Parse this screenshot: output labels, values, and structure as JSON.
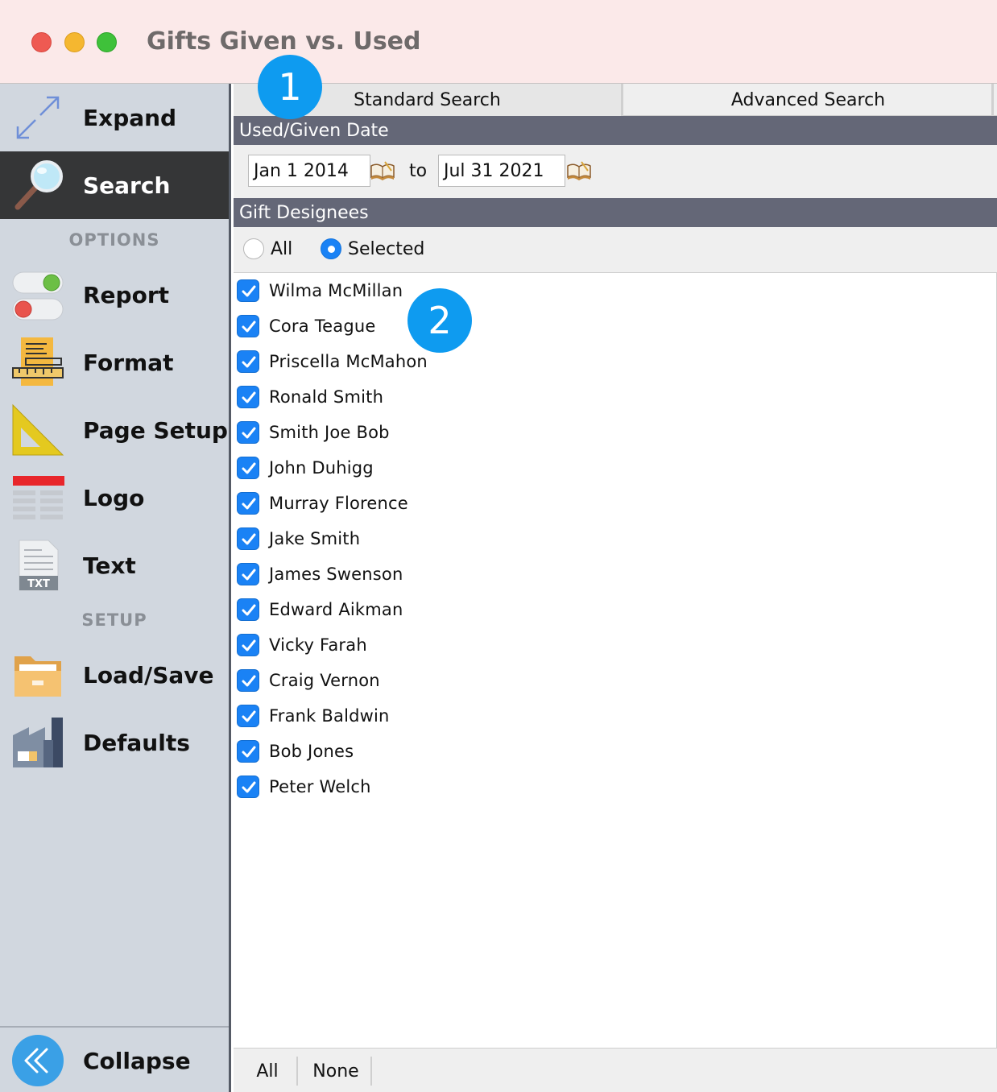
{
  "window": {
    "title": "Gifts Given vs. Used"
  },
  "sidebar": {
    "expand": {
      "label": "Expand",
      "icon": "expand-arrows-icon"
    },
    "search": {
      "label": "Search",
      "icon": "magnifier-icon"
    },
    "options_heading": "OPTIONS",
    "report": {
      "label": "Report",
      "icon": "toggle-switches-icon"
    },
    "format": {
      "label": "Format",
      "icon": "ruler-pencil-icon"
    },
    "page_setup": {
      "label": "Page Setup",
      "icon": "set-square-icon"
    },
    "logo": {
      "label": "Logo",
      "icon": "logo-layout-icon"
    },
    "text": {
      "label": "Text",
      "icon": "txt-file-icon",
      "icon_text": "TXT"
    },
    "setup_heading": "SETUP",
    "load_save": {
      "label": "Load/Save",
      "icon": "folder-icon"
    },
    "defaults": {
      "label": "Defaults",
      "icon": "factory-icon"
    },
    "collapse": {
      "label": "Collapse",
      "icon": "double-chevron-left-icon"
    }
  },
  "tabs": {
    "standard": "Standard Search",
    "advanced": "Advanced Search",
    "active": "standard"
  },
  "date_section": {
    "header": "Used/Given Date",
    "from_value": "Jan 1 2014",
    "to_label": "to",
    "to_value": "Jul 31 2021"
  },
  "designees": {
    "header": "Gift Designees",
    "radio_all": "All",
    "radio_selected": "Selected",
    "selected_option": "Selected",
    "items": [
      {
        "name": "Wilma McMillan",
        "checked": true
      },
      {
        "name": "Cora Teague",
        "checked": true
      },
      {
        "name": "Priscella McMahon",
        "checked": true
      },
      {
        "name": "Ronald Smith",
        "checked": true
      },
      {
        "name": "Smith Joe Bob",
        "checked": true
      },
      {
        "name": "John Duhigg",
        "checked": true
      },
      {
        "name": "Murray Florence",
        "checked": true
      },
      {
        "name": "Jake Smith",
        "checked": true
      },
      {
        "name": "James Swenson",
        "checked": true
      },
      {
        "name": "Edward Aikman",
        "checked": true
      },
      {
        "name": "Vicky Farah",
        "checked": true
      },
      {
        "name": "Craig Vernon",
        "checked": true
      },
      {
        "name": "Frank Baldwin",
        "checked": true
      },
      {
        "name": "Bob Jones",
        "checked": true
      },
      {
        "name": "Peter Welch",
        "checked": true
      }
    ]
  },
  "bottom_buttons": {
    "all": "All",
    "none": "None"
  },
  "callouts": {
    "one": "1",
    "two": "2"
  },
  "colors": {
    "accent": "#1a82f5",
    "section_header": "#646777",
    "callout": "#0e9bf0",
    "active_sidebar": "#353637"
  }
}
